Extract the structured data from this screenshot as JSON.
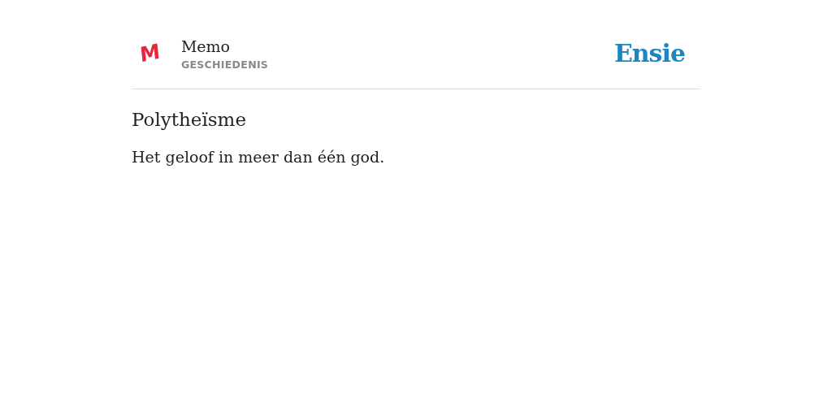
{
  "header": {
    "logo": "M",
    "title": "Memo",
    "subject": "GESCHIEDENIS",
    "brand": "Ensie"
  },
  "entry": {
    "term": "Polytheïsme",
    "definition": "Het geloof in meer dan één god."
  }
}
